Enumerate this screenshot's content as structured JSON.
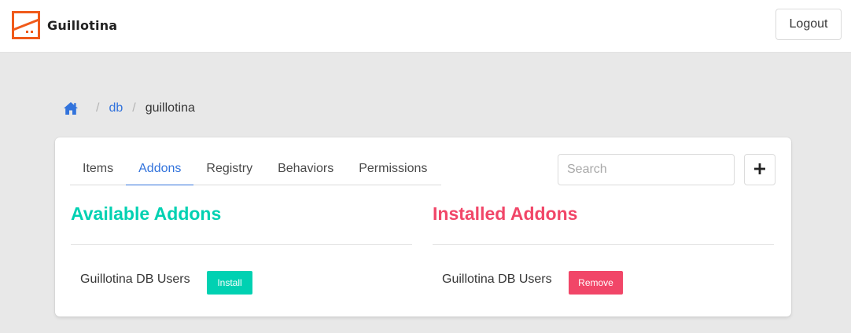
{
  "app": {
    "name": "Guillotina",
    "logo_icon": "guillotina-logo-icon",
    "brand_color": "#f05a1a"
  },
  "header": {
    "logout_label": "Logout"
  },
  "breadcrumb": {
    "home_icon": "home-icon",
    "items": [
      "db",
      "guillotina"
    ],
    "separator": "/"
  },
  "tabs": [
    {
      "label": "Items",
      "active": false
    },
    {
      "label": "Addons",
      "active": true
    },
    {
      "label": "Registry",
      "active": false
    },
    {
      "label": "Behaviors",
      "active": false
    },
    {
      "label": "Permissions",
      "active": false
    }
  ],
  "search": {
    "placeholder": "Search",
    "value": ""
  },
  "add_button": {
    "icon": "plus-icon"
  },
  "available": {
    "title": "Available Addons",
    "color": "#00d1b2",
    "addons": [
      {
        "name": "Guillotina DB Users",
        "action": "Install"
      }
    ]
  },
  "installed": {
    "title": "Installed Addons",
    "color": "#f14668",
    "addons": [
      {
        "name": "Guillotina DB Users",
        "action": "Remove"
      }
    ]
  },
  "colors": {
    "accent": "#3273dc",
    "background": "#e8e8e8"
  }
}
